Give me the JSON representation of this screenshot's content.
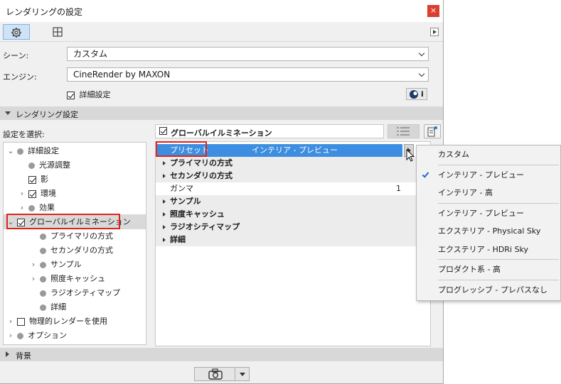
{
  "window": {
    "title": "レンダリングの設定",
    "close": "×"
  },
  "tabs": [
    {
      "name": "settings",
      "icon": "gear-icon"
    },
    {
      "name": "grid",
      "icon": "grid-icon"
    }
  ],
  "scene": {
    "label": "シーン:",
    "value": "カスタム"
  },
  "engine": {
    "label": "エンジン:",
    "value": "CineRender by MAXON"
  },
  "detail_settings": {
    "label": "詳細設定",
    "checked": true
  },
  "info_button": {
    "label": "i"
  },
  "sections": {
    "rendering": "レンダリング設定",
    "background": "背景"
  },
  "select_label": "設定を選択:",
  "panel_header": {
    "label": "グローバルイルミネーション",
    "checked": true
  },
  "tree": [
    {
      "label": "詳細設定",
      "level": 0,
      "exp": "v",
      "marker": "dot"
    },
    {
      "label": "光源調整",
      "level": 1,
      "exp": "",
      "marker": "dot"
    },
    {
      "label": "影",
      "level": 1,
      "exp": "",
      "marker": "checked"
    },
    {
      "label": "環境",
      "level": 1,
      "exp": ">",
      "marker": "checked"
    },
    {
      "label": "効果",
      "level": 1,
      "exp": ">",
      "marker": "dot"
    },
    {
      "label": "グローバルイルミネーション",
      "level": 0,
      "exp": "v",
      "marker": "checked"
    },
    {
      "label": "プライマリの方式",
      "level": 2,
      "exp": "",
      "marker": "dot"
    },
    {
      "label": "セカンダリの方式",
      "level": 2,
      "exp": "",
      "marker": "dot"
    },
    {
      "label": "サンプル",
      "level": 2,
      "exp": ">",
      "marker": "dot"
    },
    {
      "label": "照度キャッシュ",
      "level": 2,
      "exp": ">",
      "marker": "dot"
    },
    {
      "label": "ラジオシティマップ",
      "level": 2,
      "exp": "",
      "marker": "dot"
    },
    {
      "label": "詳細",
      "level": 2,
      "exp": "",
      "marker": "dot"
    },
    {
      "label": "物理的レンダーを使用",
      "level": 0,
      "exp": ">",
      "marker": "unchecked"
    },
    {
      "label": "オプション",
      "level": 0,
      "exp": ">",
      "marker": "dot"
    }
  ],
  "props": {
    "preset_label": "プリセット",
    "preset_value": "インテリア - プレビュー",
    "primary": "プライマリの方式",
    "secondary": "セカンダリの方式",
    "gamma_label": "ガンマ",
    "gamma_value": "1",
    "sample": "サンプル",
    "irradiance": "照度キャッシュ",
    "radiosity": "ラジオシティマップ",
    "detail": "詳細"
  },
  "dropdown": {
    "custom": "カスタム",
    "interior_preview_checked": "インテリア - プレビュー",
    "interior_high": "インテリア - 高",
    "interior_preview": "インテリア - プレビュー",
    "exterior_physical": "エクステリア - Physical Sky",
    "exterior_hdri": "エクステリア - HDRi Sky",
    "product_high": "プロダクト系 - 高",
    "progressive": "プログレッシブ - プレパスなし"
  },
  "colors": {
    "selection": "#3d8ee0",
    "highlight_box": "#e0241b",
    "active_tab": "#cfe3f7"
  }
}
